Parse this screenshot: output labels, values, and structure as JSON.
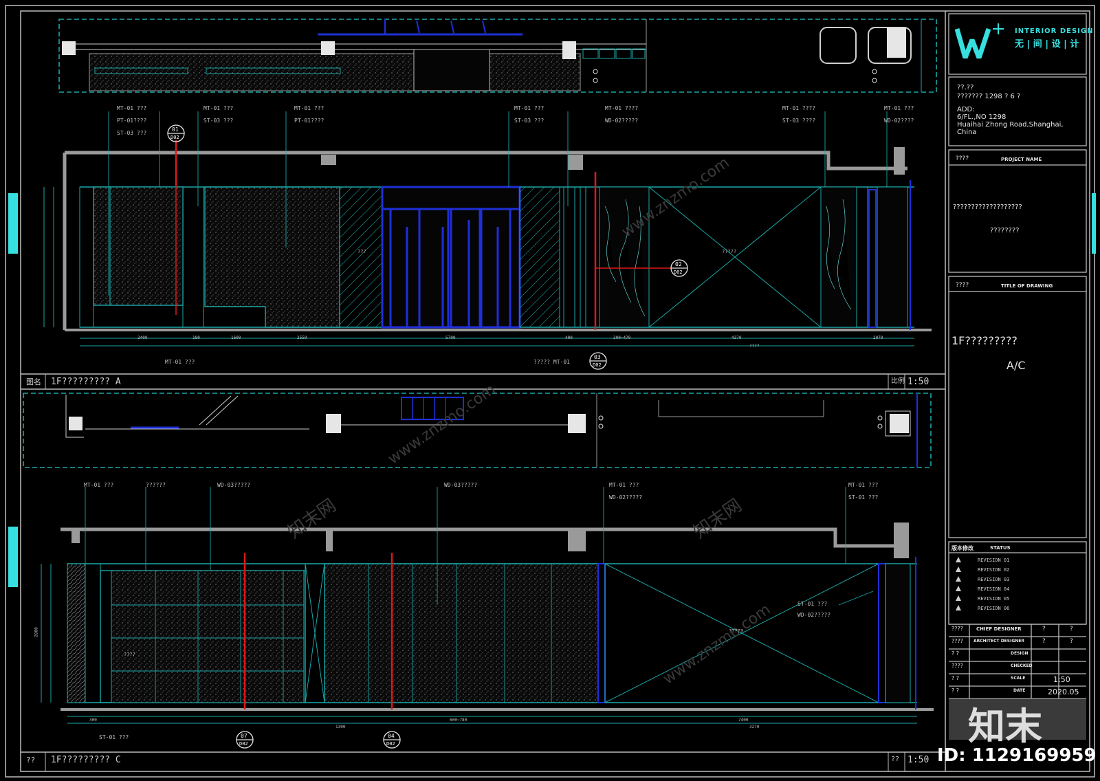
{
  "firm": {
    "logo_letter": "W",
    "logo_plus": "+",
    "name_en": "INTERIOR DESIGN",
    "name_cn": "无 | 间 | 设 | 计"
  },
  "project": {
    "line1": "??.??",
    "line2": "??????? 1298 ? 6 ?",
    "addr_label": "ADD:",
    "addr1": "6/FL.,NO 1298",
    "addr2": "Huaihai Zhong Road,Shanghai,",
    "addr3": "China"
  },
  "panels": {
    "project_label": "????",
    "project_title": "PROJECT NAME",
    "project_value1": "???????????????????",
    "project_value2": "????????",
    "drawing_label": "????",
    "drawing_title": "TITLE OF DRAWING",
    "drawing_value1": "1F?????????",
    "drawing_value2": "A/C"
  },
  "revisions": {
    "header": "版本修改",
    "status": "STATUS",
    "items": [
      "REVISION 01",
      "REVISION 02",
      "REVISION 03",
      "REVISION 04",
      "REVISION 05",
      "REVISION 06"
    ]
  },
  "signoff": [
    {
      "label": "????",
      "role": "CHIEF DESIGNER",
      "v1": "?",
      "v2": "?"
    },
    {
      "label": "????",
      "role": "ARCHITECT DESIGNER",
      "v1": "?",
      "v2": "?"
    },
    {
      "label": "?  ?",
      "role": "DESIGN",
      "v1": "",
      "v2": ""
    },
    {
      "label": "????",
      "role": "CHECKED",
      "v1": "",
      "v2": ""
    },
    {
      "label": "?  ?",
      "role": "SCALE",
      "v1": "1:50",
      "v2": ""
    },
    {
      "label": "?  ?",
      "role": "DATE",
      "v1": "2020.05",
      "v2": ""
    }
  ],
  "elevation_a": {
    "name_label": "图名",
    "name": "1F????????? A",
    "scale_label": "比例",
    "scale": "1:50",
    "callouts": [
      {
        "mark": "01",
        "sheet": "D02"
      },
      {
        "mark": "02",
        "sheet": "D02"
      },
      {
        "mark": "03",
        "sheet": "D02"
      }
    ],
    "tags": [
      "MT-01 ???",
      "PT-01????",
      "ST-03 ???",
      "MT-01 ???",
      "ST-03 ???",
      "MT-01 ???",
      "PT-01????",
      "MT-01 ???",
      "ST-03 ???",
      "MT-01 ????",
      "WD-02?????",
      "MT-01 ????",
      "ST-03 ????",
      "MT-01 ???",
      "WD-02????",
      "MT-01 ???",
      "????? MT-01"
    ],
    "centre_text": "?????",
    "door_text": "???",
    "dims": [
      "2400",
      "180",
      "1600",
      "2550",
      "5700",
      "400",
      "300~470",
      "4370",
      "2070",
      "????"
    ]
  },
  "elevation_c": {
    "name_label": "??",
    "name": "1F????????? C",
    "scale_label": "??",
    "scale": "1:50",
    "callouts": [
      {
        "mark": "07",
        "sheet": "D02"
      },
      {
        "mark": "04",
        "sheet": "D02"
      }
    ],
    "tags": [
      "MT-01 ???",
      "??????",
      "WD-03?????",
      "WD-03?????",
      "MT-01 ???",
      "WD-02?????",
      "MT-01 ???",
      "ST-01 ???",
      "ST-01 ???",
      "WD-02?????",
      "ST-01 ???"
    ],
    "centre_text": "?????",
    "left_text": "????",
    "dims": [
      "1300",
      "600~780",
      "7400",
      "3270",
      "2800",
      "300"
    ]
  },
  "watermark": {
    "brand": "知末",
    "id": "ID: 1129169959",
    "url": "www.znzmo.com",
    "site": "知末网"
  },
  "colors": {
    "cyan": "#36e0e0",
    "blue": "#1f2fd8",
    "red": "#e01818",
    "grey": "#9a9a9a",
    "white": "#e6e6e6"
  }
}
